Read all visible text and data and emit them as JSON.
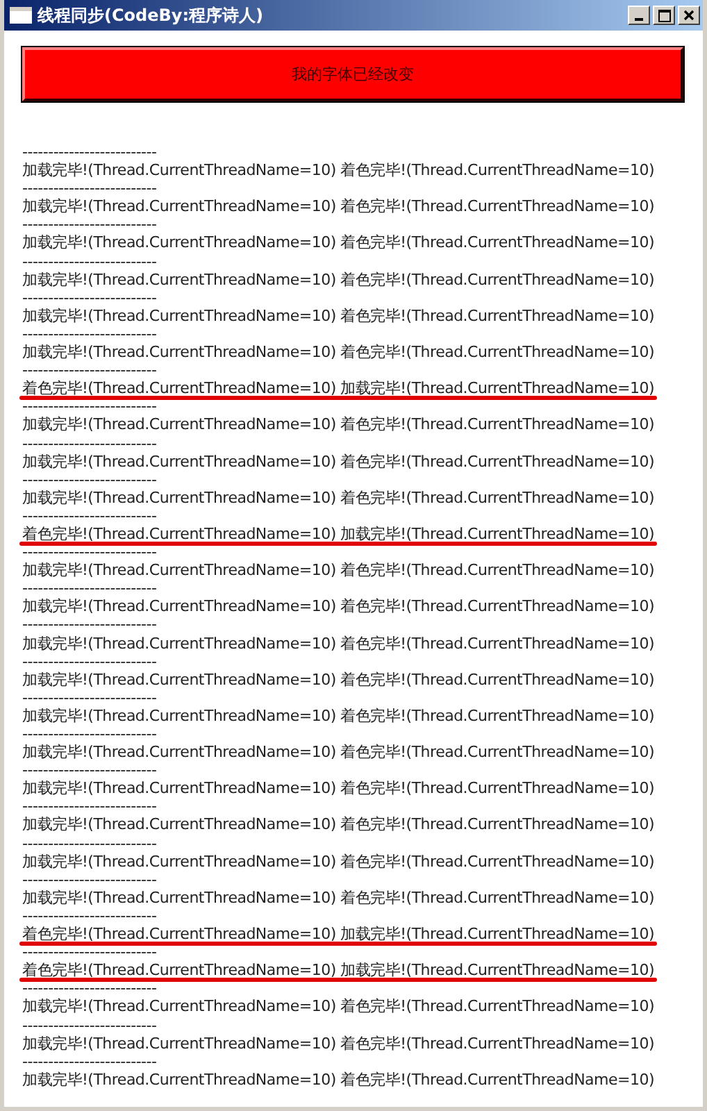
{
  "window": {
    "title": "线程同步(CodeBy:程序诗人)"
  },
  "button": {
    "label": "我的字体已经改变"
  },
  "log": [
    {
      "separator": "--------------------------",
      "text": "加载完毕!(Thread.CurrentThreadName=10) 着色完毕!(Thread.CurrentThreadName=10)",
      "underlined": false
    },
    {
      "separator": "--------------------------",
      "text": "加载完毕!(Thread.CurrentThreadName=10) 着色完毕!(Thread.CurrentThreadName=10)",
      "underlined": false
    },
    {
      "separator": "--------------------------",
      "text": "加载完毕!(Thread.CurrentThreadName=10) 着色完毕!(Thread.CurrentThreadName=10)",
      "underlined": false
    },
    {
      "separator": "--------------------------",
      "text": "加载完毕!(Thread.CurrentThreadName=10) 着色完毕!(Thread.CurrentThreadName=10)",
      "underlined": false
    },
    {
      "separator": "--------------------------",
      "text": "加载完毕!(Thread.CurrentThreadName=10) 着色完毕!(Thread.CurrentThreadName=10)",
      "underlined": false
    },
    {
      "separator": "--------------------------",
      "text": "加载完毕!(Thread.CurrentThreadName=10) 着色完毕!(Thread.CurrentThreadName=10)",
      "underlined": false
    },
    {
      "separator": "--------------------------",
      "text": "着色完毕!(Thread.CurrentThreadName=10) 加载完毕!(Thread.CurrentThreadName=10)",
      "underlined": true
    },
    {
      "separator": "--------------------------",
      "text": "加载完毕!(Thread.CurrentThreadName=10) 着色完毕!(Thread.CurrentThreadName=10)",
      "underlined": false
    },
    {
      "separator": "--------------------------",
      "text": "加载完毕!(Thread.CurrentThreadName=10) 着色完毕!(Thread.CurrentThreadName=10)",
      "underlined": false
    },
    {
      "separator": "--------------------------",
      "text": "加载完毕!(Thread.CurrentThreadName=10) 着色完毕!(Thread.CurrentThreadName=10)",
      "underlined": false
    },
    {
      "separator": "--------------------------",
      "text": "着色完毕!(Thread.CurrentThreadName=10) 加载完毕!(Thread.CurrentThreadName=10)",
      "underlined": true
    },
    {
      "separator": "--------------------------",
      "text": "加载完毕!(Thread.CurrentThreadName=10) 着色完毕!(Thread.CurrentThreadName=10)",
      "underlined": false
    },
    {
      "separator": "--------------------------",
      "text": "加载完毕!(Thread.CurrentThreadName=10) 着色完毕!(Thread.CurrentThreadName=10)",
      "underlined": false
    },
    {
      "separator": "--------------------------",
      "text": "加载完毕!(Thread.CurrentThreadName=10) 着色完毕!(Thread.CurrentThreadName=10)",
      "underlined": false
    },
    {
      "separator": "--------------------------",
      "text": "加载完毕!(Thread.CurrentThreadName=10) 着色完毕!(Thread.CurrentThreadName=10)",
      "underlined": false
    },
    {
      "separator": "--------------------------",
      "text": "加载完毕!(Thread.CurrentThreadName=10) 着色完毕!(Thread.CurrentThreadName=10)",
      "underlined": false
    },
    {
      "separator": "--------------------------",
      "text": "加载完毕!(Thread.CurrentThreadName=10) 着色完毕!(Thread.CurrentThreadName=10)",
      "underlined": false
    },
    {
      "separator": "--------------------------",
      "text": "加载完毕!(Thread.CurrentThreadName=10) 着色完毕!(Thread.CurrentThreadName=10)",
      "underlined": false
    },
    {
      "separator": "--------------------------",
      "text": "加载完毕!(Thread.CurrentThreadName=10) 着色完毕!(Thread.CurrentThreadName=10)",
      "underlined": false
    },
    {
      "separator": "--------------------------",
      "text": "加载完毕!(Thread.CurrentThreadName=10) 着色完毕!(Thread.CurrentThreadName=10)",
      "underlined": false
    },
    {
      "separator": "--------------------------",
      "text": "加载完毕!(Thread.CurrentThreadName=10) 着色完毕!(Thread.CurrentThreadName=10)",
      "underlined": false
    },
    {
      "separator": "--------------------------",
      "text": "着色完毕!(Thread.CurrentThreadName=10) 加载完毕!(Thread.CurrentThreadName=10)",
      "underlined": true
    },
    {
      "separator": "--------------------------",
      "text": "着色完毕!(Thread.CurrentThreadName=10) 加载完毕!(Thread.CurrentThreadName=10)",
      "underlined": true
    },
    {
      "separator": "--------------------------",
      "text": "加载完毕!(Thread.CurrentThreadName=10) 着色完毕!(Thread.CurrentThreadName=10)",
      "underlined": false
    },
    {
      "separator": "--------------------------",
      "text": "加载完毕!(Thread.CurrentThreadName=10) 着色完毕!(Thread.CurrentThreadName=10)",
      "underlined": false
    },
    {
      "separator": "--------------------------",
      "text": "加载完毕!(Thread.CurrentThreadName=10) 着色完毕!(Thread.CurrentThreadName=10)",
      "underlined": false
    }
  ]
}
